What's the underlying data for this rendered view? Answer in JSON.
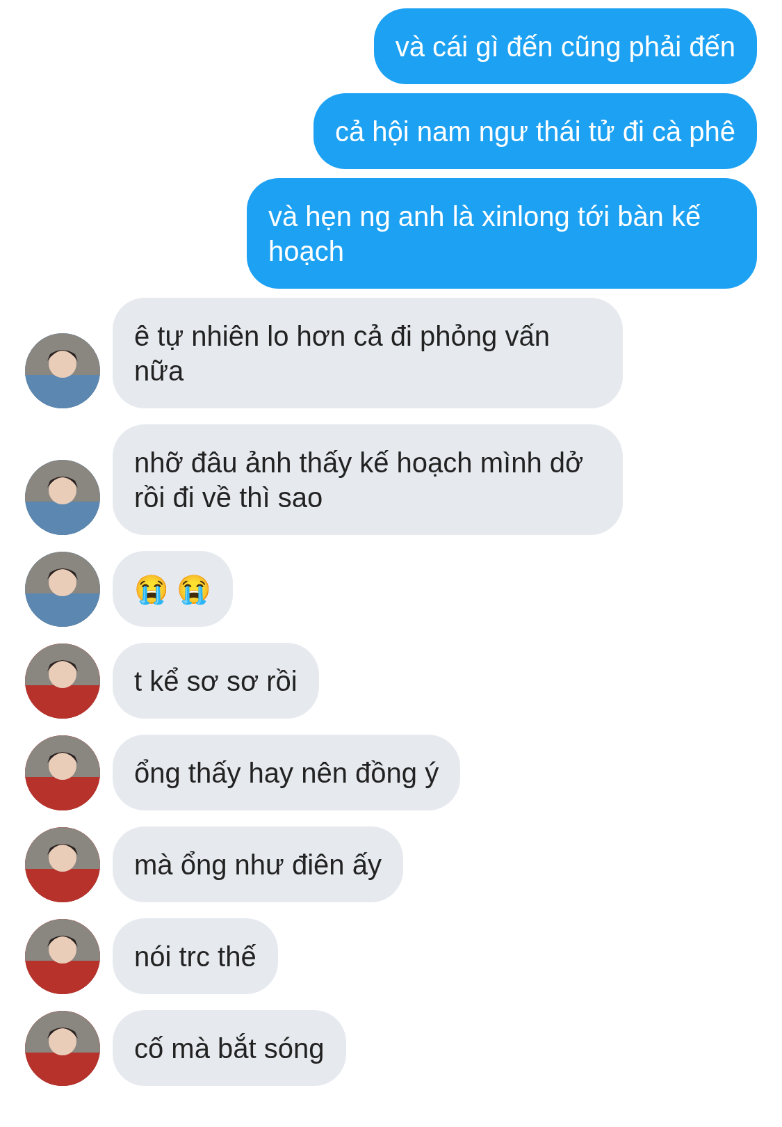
{
  "messages": [
    {
      "kind": "outgoing",
      "text": "và cái gì đến cũng phải đến"
    },
    {
      "kind": "outgoing",
      "text": "cả hội nam ngư thái tử đi cà phê"
    },
    {
      "kind": "outgoing",
      "text": "và hẹn ng anh là xinlong tới bàn kế hoạch"
    },
    {
      "kind": "incoming",
      "text": "ê tự nhiên lo hơn cả đi phỏng vấn nữa",
      "color": "#5b87b0"
    },
    {
      "kind": "incoming",
      "text": "nhỡ đâu ảnh thấy kế hoạch mình dở rồi đi về thì sao",
      "color": "#5b87b0"
    },
    {
      "kind": "incoming",
      "text": "😭 😭",
      "color": "#5b87b0"
    },
    {
      "kind": "incoming",
      "text": "t kể sơ sơ rồi",
      "color": "#b8322c"
    },
    {
      "kind": "incoming",
      "text": "ổng thấy hay nên đồng ý",
      "color": "#b8322c"
    },
    {
      "kind": "incoming",
      "text": "mà ổng như điên ấy",
      "color": "#b8322c"
    },
    {
      "kind": "incoming",
      "text": "nói trc thế",
      "color": "#b8322c"
    },
    {
      "kind": "incoming",
      "text": "cố mà bắt sóng",
      "color": "#b8322c"
    }
  ]
}
